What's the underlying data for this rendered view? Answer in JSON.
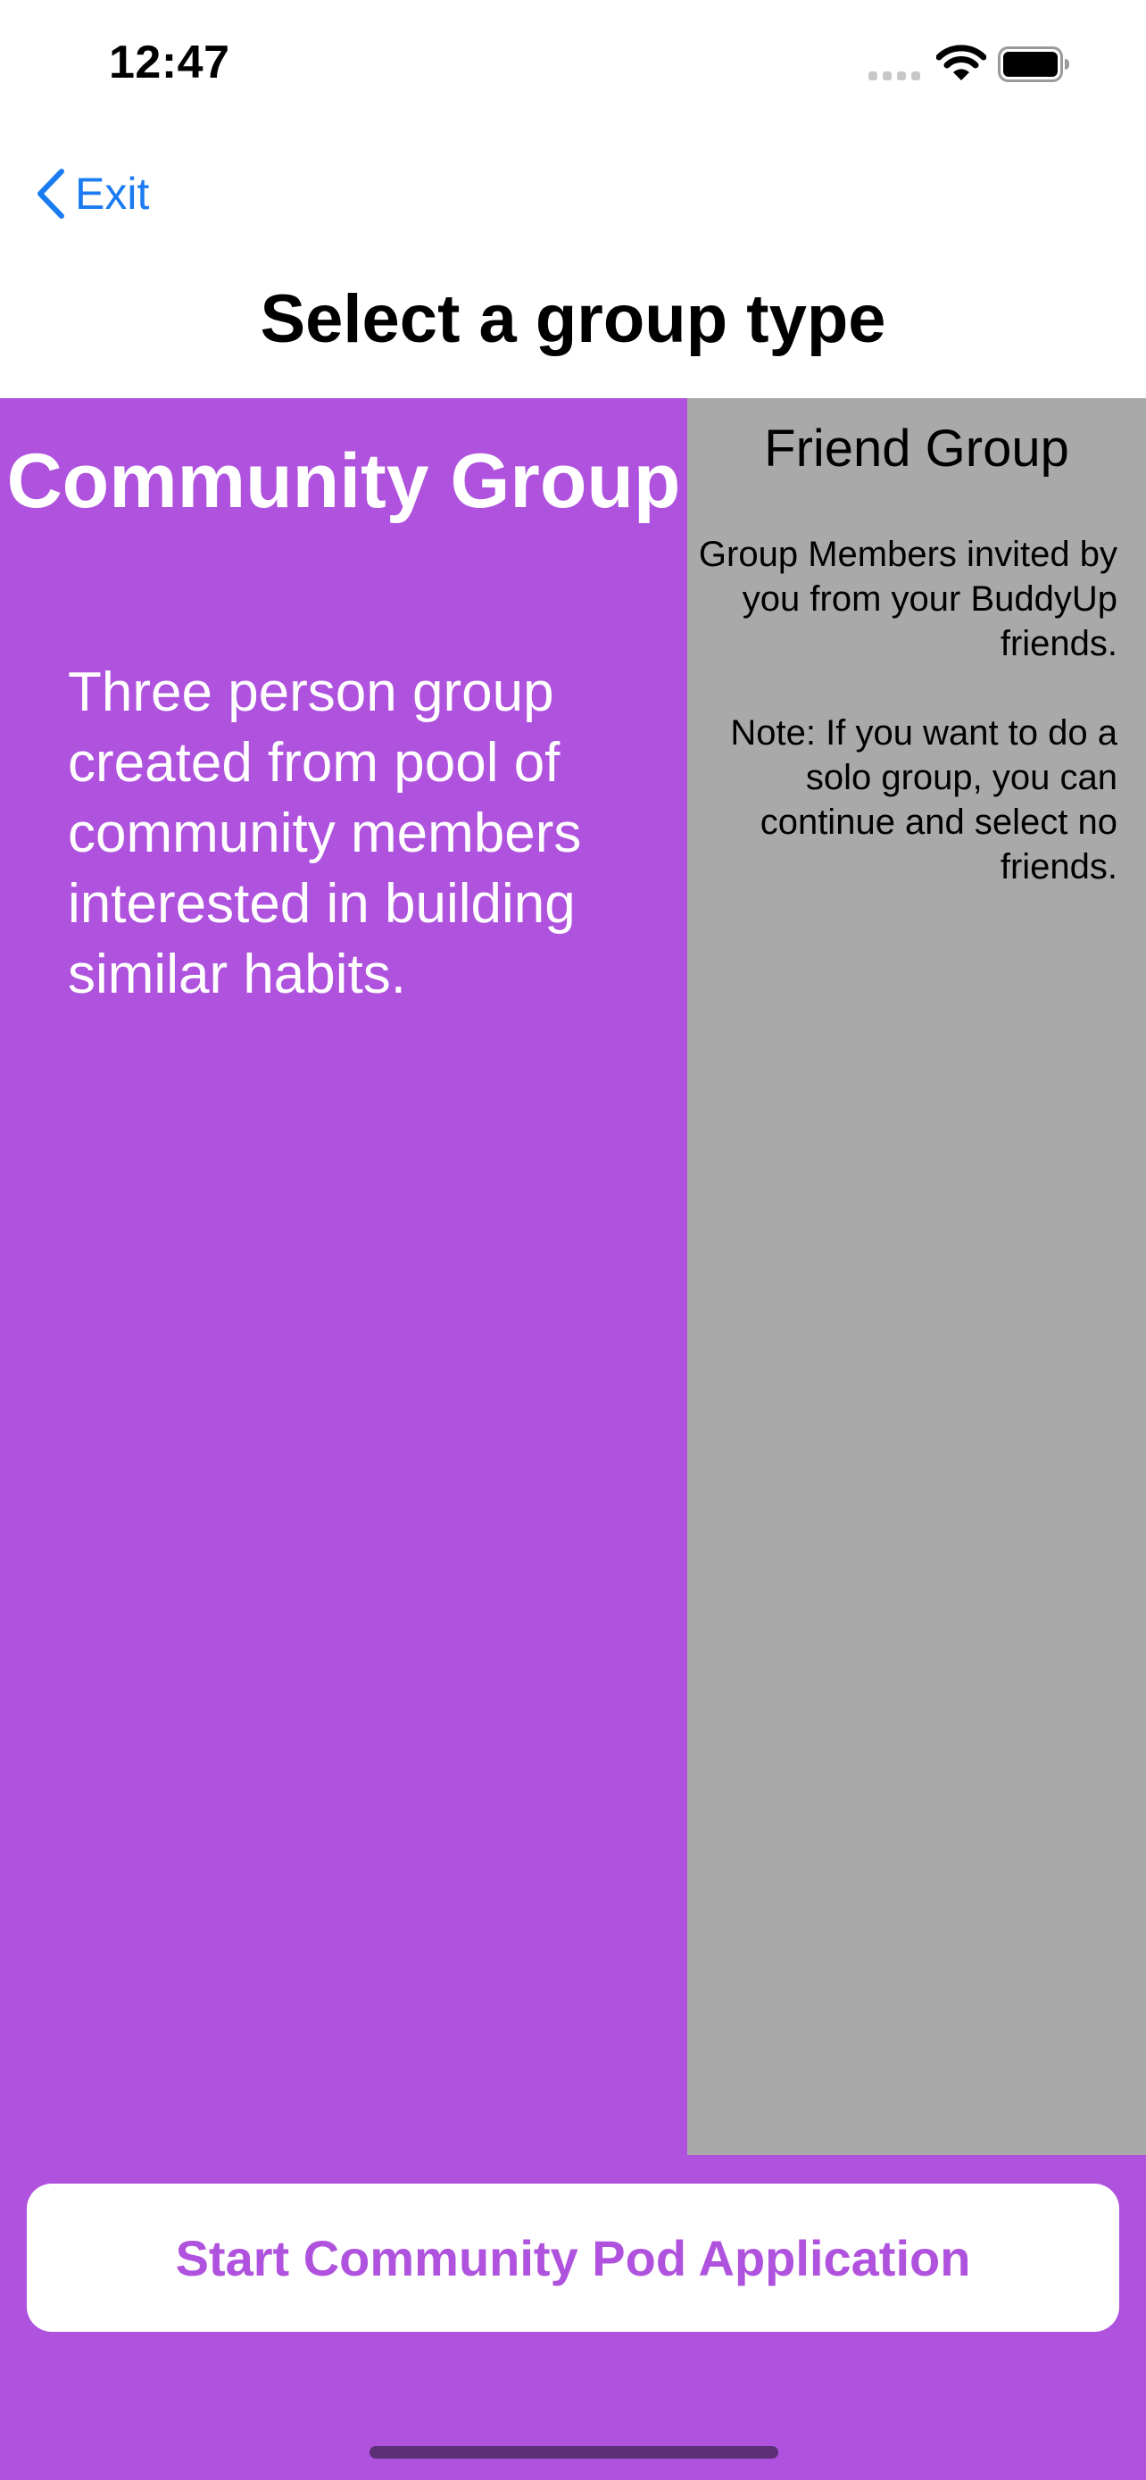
{
  "status_bar": {
    "time": "12:47"
  },
  "nav": {
    "back_label": "Exit",
    "back_icon": "chevron-left-icon"
  },
  "page": {
    "title": "Select a group type"
  },
  "community_group": {
    "title": "Community Group",
    "description": "Three person group created from pool of community members interested in building similar habits."
  },
  "friend_group": {
    "title": "Friend Group",
    "description": "Group Members invited by you from your BuddyUp friends.",
    "note": "Note: If you want to do a solo group, you can continue and select no friends."
  },
  "action": {
    "start_label": "Start Community Pod Application"
  },
  "colors": {
    "accent": "#af52de",
    "friend_card_bg": "#a9a9a9",
    "link_blue": "#1a7bf2",
    "button_bg": "#ffffff"
  }
}
